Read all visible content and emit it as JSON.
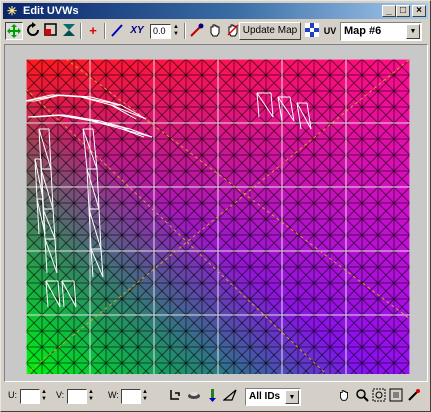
{
  "window": {
    "title": "Edit UVWs",
    "minimize": "_",
    "maximize": "□",
    "close": "×"
  },
  "toolbar": {
    "spinner_value": "0.0",
    "xy_label": "XY",
    "update_map": "Update Map",
    "uv_label": "UV",
    "map_select": "Map #6"
  },
  "bottombar": {
    "u_label": "U:",
    "v_label": "V:",
    "w_label": "W:",
    "id_select": "All IDs"
  },
  "colors": {
    "accent_green": "#00a000",
    "accent_red": "#e00000",
    "accent_blue": "#0000c0"
  }
}
